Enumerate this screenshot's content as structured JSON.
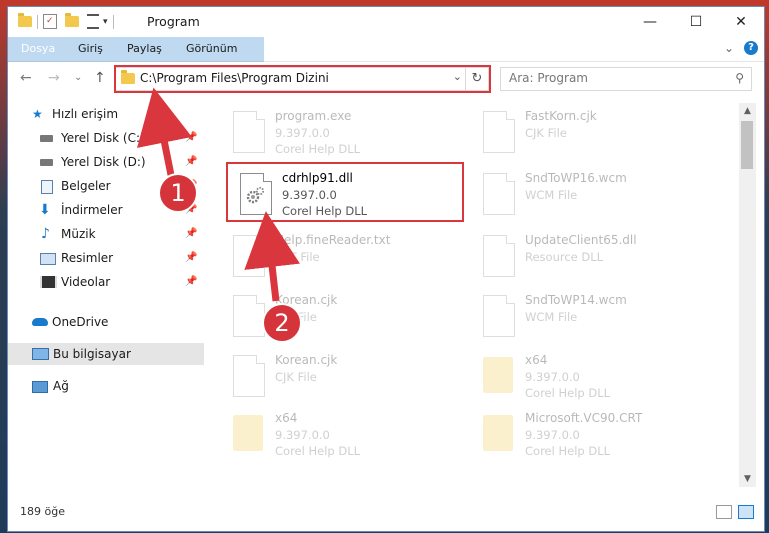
{
  "window": {
    "title": "Program",
    "controls": {
      "minimize": "—",
      "maximize": "☐",
      "close": "✕"
    }
  },
  "ribbon": {
    "tabs": [
      "Dosya",
      "Giriş",
      "Paylaş",
      "Görünüm"
    ],
    "expand_glyph": "⌄",
    "help_glyph": "?"
  },
  "nav": {
    "back": "←",
    "forward": "→",
    "recent": "⌄",
    "up": "↑",
    "address": "C:\\Program Files\\Program Dizini",
    "dropdown_glyph": "⌄",
    "refresh_glyph": "↻",
    "search_placeholder": "Ara: Program",
    "search_glyph": "⚲"
  },
  "sidebar": {
    "items": [
      {
        "label": "Hızlı erişim",
        "icon": "star-icon",
        "pinned": false
      },
      {
        "label": "Yerel Disk (C:)",
        "icon": "drive-icon",
        "pinned": true
      },
      {
        "label": "Yerel Disk (D:)",
        "icon": "drive-icon",
        "pinned": true
      },
      {
        "label": "Belgeler",
        "icon": "document-icon",
        "pinned": true
      },
      {
        "label": "İndirmeler",
        "icon": "download-icon",
        "pinned": true
      },
      {
        "label": "Müzik",
        "icon": "music-icon",
        "pinned": true
      },
      {
        "label": "Resimler",
        "icon": "picture-icon",
        "pinned": true
      },
      {
        "label": "Videolar",
        "icon": "video-icon",
        "pinned": true
      },
      {
        "label": "OneDrive",
        "icon": "cloud-icon",
        "pinned": false
      },
      {
        "label": "Bu bilgisayar",
        "icon": "computer-icon",
        "pinned": false,
        "selected": true
      },
      {
        "label": "Ağ",
        "icon": "network-icon",
        "pinned": false
      }
    ],
    "pin_glyph": "📌"
  },
  "files": [
    {
      "name": "program.exe",
      "line2": "9.397.0.0",
      "line3": "Corel Help DLL",
      "kind": "exe"
    },
    {
      "name": "FastKorn.cjk",
      "line2": "CJK File",
      "line3": "",
      "kind": "doc"
    },
    {
      "name": "cdrhlp91.dll",
      "line2": "9.397.0.0",
      "line3": "Corel Help DLL",
      "kind": "dll",
      "highlighted": true
    },
    {
      "name": "SndToWP16.wcm",
      "line2": "WCM File",
      "line3": "",
      "kind": "doc"
    },
    {
      "name": "Help.fineReader.txt",
      "line2": "TXT File",
      "line3": "",
      "kind": "doc"
    },
    {
      "name": "UpdateClient65.dll",
      "line2": "Resource DLL",
      "line3": "",
      "kind": "dll"
    },
    {
      "name": "Korean.cjk",
      "line2": "CJK File",
      "line3": "",
      "kind": "doc"
    },
    {
      "name": "SndToWP14.wcm",
      "line2": "WCM File",
      "line3": "",
      "kind": "doc"
    },
    {
      "name": "Korean.cjk",
      "line2": "CJK File",
      "line3": "",
      "kind": "doc"
    },
    {
      "name": "x64",
      "line2": "9.397.0.0",
      "line3": "Corel Help DLL",
      "kind": "folder"
    },
    {
      "name": "x64",
      "line2": "9.397.0.0",
      "line3": "Corel Help DLL",
      "kind": "folder"
    },
    {
      "name": "Microsoft.VC90.CRT",
      "line2": "9.397.0.0",
      "line3": "Corel Help DLL",
      "kind": "folder"
    }
  ],
  "status": {
    "count": "189 öğe"
  },
  "annotations": {
    "badge1": "1",
    "badge2": "2"
  },
  "colors": {
    "accent": "#1979ca",
    "annotation_red": "#d9363e"
  }
}
